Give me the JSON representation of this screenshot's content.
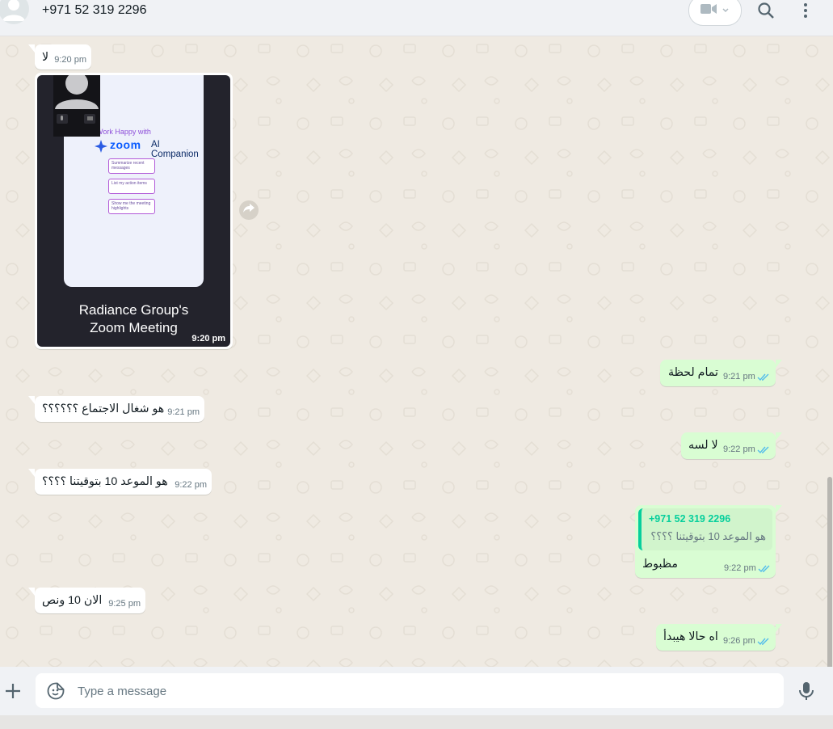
{
  "header": {
    "contact_name": "+971 52 319 2296",
    "icons": [
      "avatar",
      "video-call-icon",
      "chevron-down-icon",
      "search-icon",
      "menu-icon"
    ]
  },
  "messages": [
    {
      "dir": "in",
      "text": "لا",
      "time": "9:20 pm"
    },
    {
      "dir": "in",
      "type": "image",
      "caption_line1": "Radiance Group's",
      "caption_line2": "Zoom Meeting",
      "time": "9:20 pm",
      "screen": {
        "work": "Work Happy with",
        "zoom": "zoom",
        "ai": "AI Companion",
        "chips": [
          "Summarize recent messages",
          "List my action items",
          "Show me the meeting highlights"
        ]
      }
    },
    {
      "dir": "out",
      "text": "تمام لحظة",
      "time": "9:21 pm",
      "status": "read"
    },
    {
      "dir": "in",
      "text": "هو شغال الاجتماع ؟؟؟؟؟؟",
      "time": "9:21 pm"
    },
    {
      "dir": "out",
      "text": "لا لسه",
      "time": "9:22 pm",
      "status": "read"
    },
    {
      "dir": "in",
      "text": "هو الموعد 10 بتوقيتنا ؟؟؟؟",
      "time": "9:22 pm"
    },
    {
      "dir": "out",
      "type": "reply",
      "quoted_name": "+971 52 319 2296",
      "quoted_text": "هو الموعد 10 بتوقيتنا ؟؟؟؟",
      "text": "مظبوط",
      "time": "9:22 pm",
      "status": "read"
    },
    {
      "dir": "in",
      "text": "الان 10 ونص",
      "time": "9:25 pm"
    },
    {
      "dir": "out",
      "text": "اه حالا هيبدأ",
      "time": "9:26 pm",
      "status": "read"
    }
  ],
  "composer": {
    "placeholder": "Type a message",
    "value": ""
  },
  "colors": {
    "chat_bg": "#efeae2",
    "incoming_bubble": "#ffffff",
    "outgoing_bubble": "#d9fdd3",
    "read_ticks": "#53bdeb",
    "accent": "#06cf9c"
  }
}
